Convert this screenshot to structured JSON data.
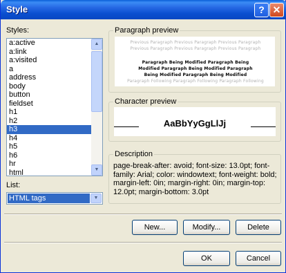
{
  "window": {
    "title": "Style",
    "help_glyph": "?",
    "close_glyph": "✕"
  },
  "styles": {
    "label": "Styles:",
    "items": [
      "a:active",
      "a:link",
      "a:visited",
      "a",
      "address",
      "body",
      "button",
      "fieldset",
      "h1",
      "h2",
      "h3",
      "h4",
      "h5",
      "h6",
      "hr",
      "html"
    ],
    "selected": "h3"
  },
  "list": {
    "label": "List:",
    "value": "HTML tags"
  },
  "paragraph_preview": {
    "label": "Paragraph preview",
    "previous_lines": [
      "Previous Paragraph Previous Paragraph Previous Paragraph",
      "Previous Paragraph Previous Paragraph Previous Paragraph"
    ],
    "modified_lines": [
      "Paragraph Being Modified Paragraph Being",
      "Modified Paragraph Being Modified Paragraph",
      "Being Modified Paragraph Being Modified"
    ],
    "following_line": "Paragraph Following Paragraph Following Paragraph Following"
  },
  "character_preview": {
    "label": "Character preview",
    "sample": "AaBbYyGgLlJj"
  },
  "description": {
    "label": "Description",
    "text": "page-break-after: avoid; font-size: 13.0pt; font-family: Arial; color: windowtext; font-weight: bold; margin-left: 0in; margin-right: 0in; margin-top: 12.0pt; margin-bottom: 3.0pt"
  },
  "buttons": {
    "new": "New...",
    "modify": "Modify...",
    "delete": "Delete",
    "ok": "OK",
    "cancel": "Cancel"
  },
  "colors": {
    "titlebar": "#0a4fd0",
    "selection": "#316ac5",
    "dialog_bg": "#ece9d8"
  }
}
